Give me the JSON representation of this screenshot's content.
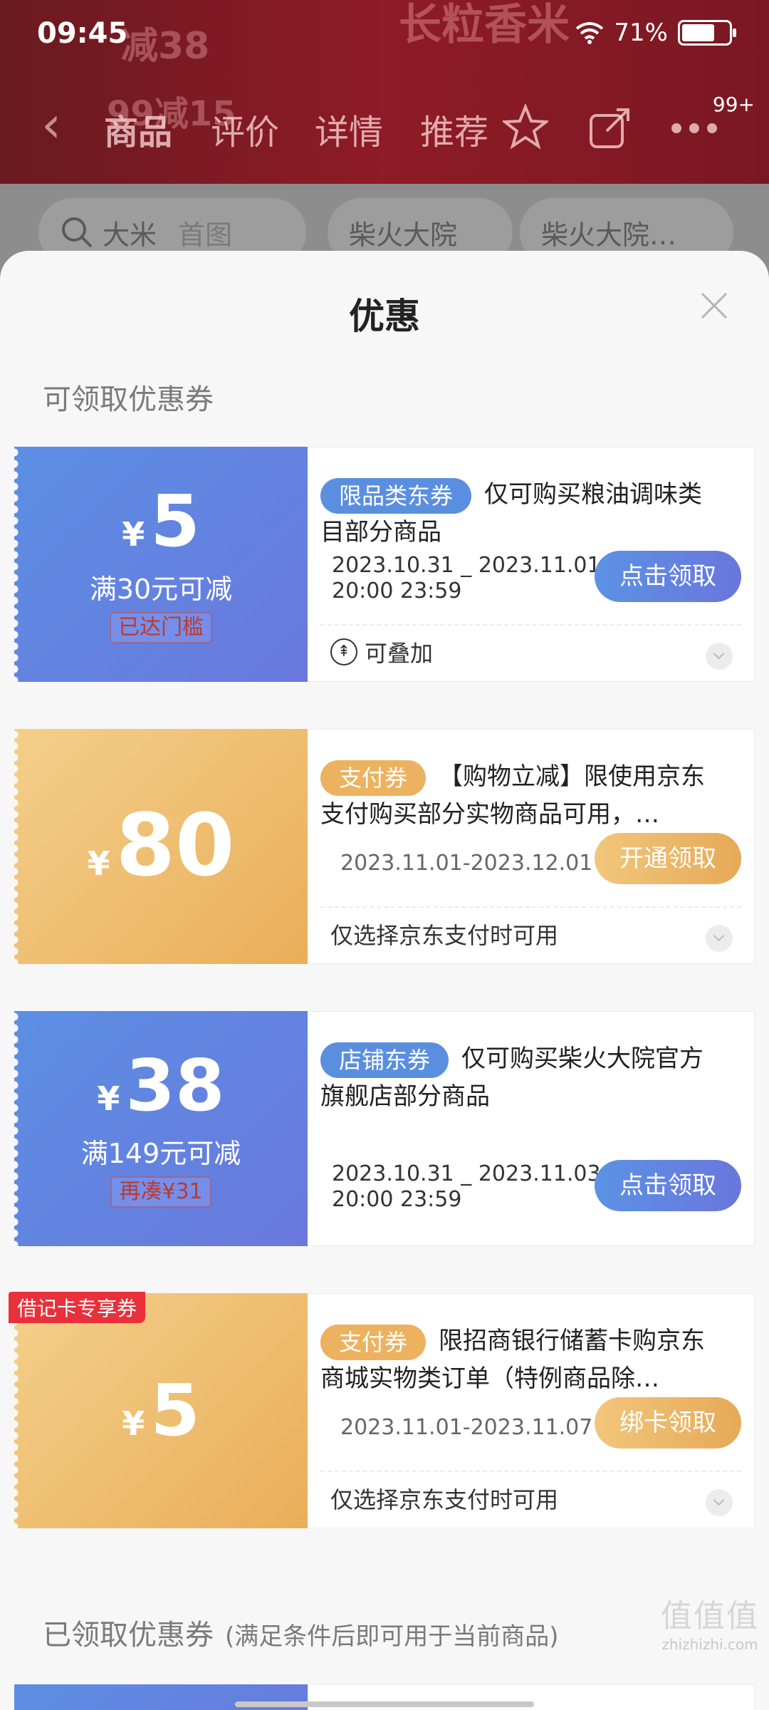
{
  "status_bar": {
    "time": "09:45",
    "battery": "71%",
    "battery_level": 0.71
  },
  "background": {
    "banner_text_1": "长粒香米",
    "banner_text_2": "减38",
    "banner_text_3": "99减15",
    "nav": {
      "back_icon": "chevron-left-icon",
      "tabs": [
        "商品",
        "评价",
        "详情",
        "推荐"
      ],
      "badge": "99+"
    },
    "search": {
      "query": "大米",
      "hint": "首图"
    },
    "shop_pills": [
      "柴火大院",
      "柴火大院…"
    ]
  },
  "sheet": {
    "title": "优惠",
    "available_section": "可领取优惠券",
    "claimed_section": "已领取优惠券",
    "claimed_section_note": "(满足条件后即可用于当前商品)"
  },
  "coupons": [
    {
      "style": "blue",
      "yen": "¥",
      "amount": "5",
      "condition": "满30元可减",
      "threshold_tag": "已达门槛",
      "chip": "限品类东券",
      "description": "仅可购买粮油调味类目部分商品",
      "date_line1": "2023.10.31 _ 2023.11.01",
      "date_line2": "20:00 23:59",
      "button": "点击领取",
      "footer": "可叠加"
    },
    {
      "style": "gold",
      "yen": "¥",
      "amount": "80",
      "chip": "支付券",
      "description": "【购物立减】限使用京东支付购买部分实物商品可用，…",
      "dates": "2023.11.01-2023.12.01",
      "button": "开通领取",
      "footer": "仅选择京东支付时可用"
    },
    {
      "style": "blue",
      "yen": "¥",
      "amount": "38",
      "condition": "满149元可减",
      "threshold_tag": "再凑¥31",
      "chip": "店铺东券",
      "description": "仅可购买柴火大院官方旗舰店部分商品",
      "date_line1": "2023.10.31 _ 2023.11.03",
      "date_line2": "20:00 23:59",
      "button": "点击领取"
    },
    {
      "style": "gold",
      "ribbon": "借记卡专享券",
      "yen": "¥",
      "amount": "5",
      "chip": "支付券",
      "description": "限招商银行储蓄卡购京东商城实物类订单（特例商品除…",
      "dates": "2023.11.01-2023.11.07",
      "button": "绑卡领取",
      "footer": "仅选择京东支付时可用"
    }
  ],
  "watermark": {
    "logo": "值值值",
    "site": "zhizhizhi.com"
  },
  "colors": {
    "blue_start": "#5b8fe3",
    "blue_end": "#6a78dd",
    "gold_start": "#f4cf8a",
    "gold_end": "#e9ae5a",
    "badge_red": "#e8313a"
  }
}
